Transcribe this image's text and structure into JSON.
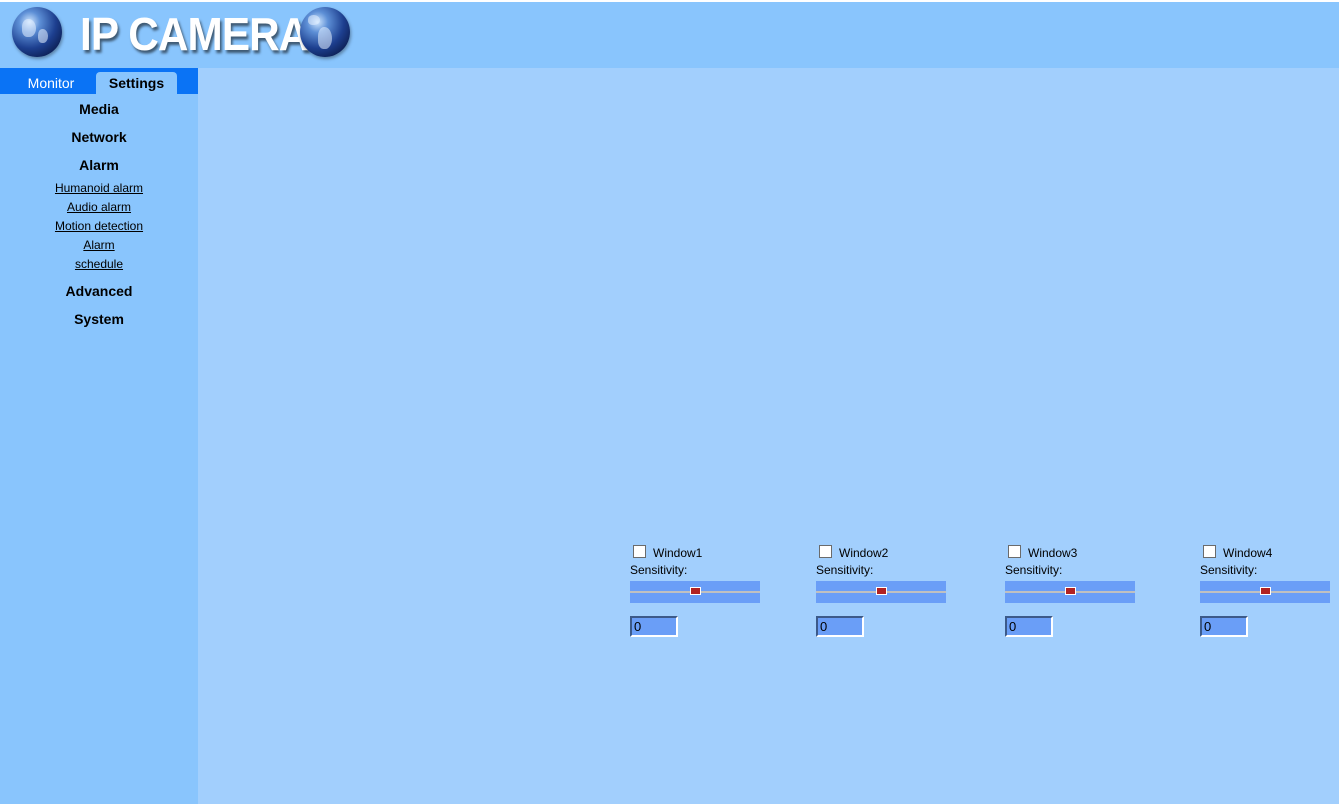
{
  "header": {
    "title": "IP CAMERA",
    "left_icon": "globe-icon",
    "right_icon": "globe-icon"
  },
  "tabs": [
    {
      "label": "Monitor"
    },
    {
      "label": "Settings"
    }
  ],
  "menu": {
    "media": "Media",
    "network": "Network",
    "alarm": "Alarm",
    "alarm_items": [
      "Humanoid alarm",
      "Audio alarm",
      "Motion detection",
      "Alarm",
      "schedule"
    ],
    "advanced": "Advanced",
    "system": "System"
  },
  "windows": [
    {
      "label": "Window1",
      "sensitivity_label": "Sensitivity:",
      "value": "0",
      "checked": false,
      "slider_fraction": 0.5
    },
    {
      "label": "Window2",
      "sensitivity_label": "Sensitivity:",
      "value": "0",
      "checked": false,
      "slider_fraction": 0.5
    },
    {
      "label": "Window3",
      "sensitivity_label": "Sensitivity:",
      "value": "0",
      "checked": false,
      "slider_fraction": 0.5
    },
    {
      "label": "Window4",
      "sensitivity_label": "Sensitivity:",
      "value": "0",
      "checked": false,
      "slider_fraction": 0.5
    }
  ],
  "colors": {
    "header_bg": "#89c5fd",
    "content_bg": "#a2cffd",
    "tab_bar": "#0a73f5",
    "slider_bg": "#6a9ef7",
    "slider_thumb": "#b22222"
  }
}
